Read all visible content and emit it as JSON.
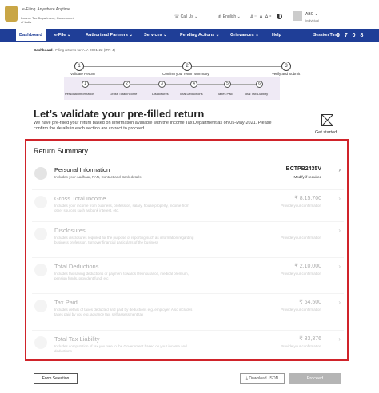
{
  "header": {
    "logo_title": "e-Filing",
    "logo_tag": "Anywhere Anytime",
    "logo_sub": "Income Tax Department, Government of India",
    "call_us": "Call Us",
    "language": "English",
    "font_sizes": "A⁻ A A⁺",
    "user_name": "ABC",
    "user_type": "Individual"
  },
  "nav": {
    "items": [
      "Dashboard",
      "e-File",
      "Authorised Partners",
      "Services",
      "Pending Actions",
      "Grievances",
      "Help"
    ],
    "session_label": "Session Time",
    "session_value": "0 7 0 8"
  },
  "breadcrumb": {
    "home": "Dashboard",
    "current": "/ Filing returns for A.Y. 2021-22 (ITR-4)"
  },
  "steps": [
    {
      "num": "1",
      "label": "Validate Return"
    },
    {
      "num": "2",
      "label": "Confirm your return summary"
    },
    {
      "num": "3",
      "label": "Verify and Submit"
    }
  ],
  "substeps": [
    {
      "num": "1",
      "label": "Personal Information"
    },
    {
      "num": "2",
      "label": "Gross Total Income"
    },
    {
      "num": "3",
      "label": "Disclosures"
    },
    {
      "num": "4",
      "label": "Total Deductions"
    },
    {
      "num": "5",
      "label": "Taxes Paid"
    },
    {
      "num": "6",
      "label": "Total Tax Liability"
    }
  ],
  "main": {
    "title": "Let’s validate your pre-filled return",
    "description": "We have pre-filled your return based on information available with the Income Tax Department as on 05-May-2021. Please confirm the details in each section are correct to proceed.",
    "get_started": "Get started",
    "summary_title": "Return Summary"
  },
  "rows": [
    {
      "name": "Personal Information",
      "desc": "Includes your Aadhaar, PAN, Contact and Bank details",
      "value": "BCTPB2435V",
      "sub": "Modify if required"
    },
    {
      "name": "Gross Total Income",
      "desc": "Includes your income from business, profession, salary, house property, income from other sources such as bank interest, etc.",
      "value": "₹ 8,15,700",
      "sub": "Provide your confirmation"
    },
    {
      "name": "Disclosures",
      "desc": "Includes disclosures required for the purpose of reporting such as information regarding business profession, turnover financial particulars of the business",
      "value": "",
      "sub": "Provide your confirmation"
    },
    {
      "name": "Total Deductions",
      "desc": "Includes tax saving deductions or payment towards life insurance, medical premium, pension funds, provident fund, etc",
      "value": "₹ 2,10,000",
      "sub": "Provide your confirmation"
    },
    {
      "name": "Tax Paid",
      "desc": "Includes details of taxes deducted and paid by deductions e.g. employer. Also includes taxes paid by you e.g. advance tax, self assessment tax",
      "value": "₹ 64,500",
      "sub": "Provide your confirmation"
    },
    {
      "name": "Total Tax Liability",
      "desc": "Includes computation of tax you owe to the Government based on your income and deductions",
      "value": "₹ 33,376",
      "sub": "Provide your confirmation"
    }
  ],
  "buttons": {
    "form_selection": "Form Selection",
    "download_json": "Download JSON",
    "proceed": "Proceed"
  }
}
